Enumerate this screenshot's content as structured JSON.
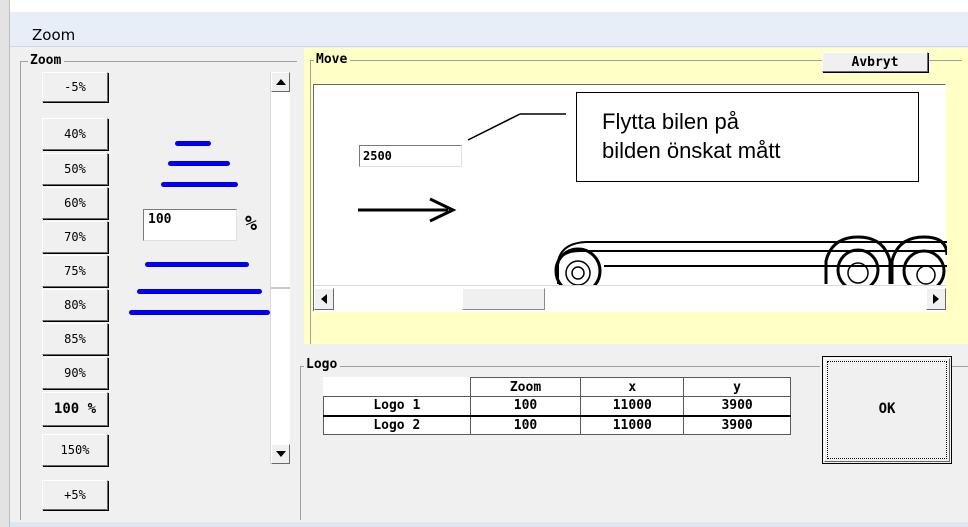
{
  "window": {
    "title": "Zoom"
  },
  "zoom_panel": {
    "legend": "Zoom",
    "minus_button": "-5%",
    "plus_button": "+5%",
    "presets": [
      "40%",
      "50%",
      "60%",
      "70%",
      "75%",
      "80%",
      "85%",
      "90%",
      "100 %",
      "150%"
    ],
    "active_preset": "100 %",
    "value": "100",
    "unit": "%"
  },
  "move_panel": {
    "legend": "Move",
    "cancel_button": "Avbryt",
    "offset_value": "2500",
    "callout_text_line1": "Flytta bilen på",
    "callout_text_line2": "bilden önskat mått"
  },
  "logo_panel": {
    "legend": "Logo",
    "columns": [
      "Zoom",
      "x",
      "y"
    ],
    "rows": [
      {
        "name": "Logo 1",
        "zoom": "100",
        "x": "11000",
        "y": "3900"
      },
      {
        "name": "Logo 2",
        "zoom": "100",
        "x": "11000",
        "y": "3900"
      }
    ]
  },
  "ok_button": "OK",
  "colors": {
    "yellow_panel": "#ffffc6",
    "bar_blue": "#0000ee",
    "window_bg": "#f0f0f0"
  }
}
